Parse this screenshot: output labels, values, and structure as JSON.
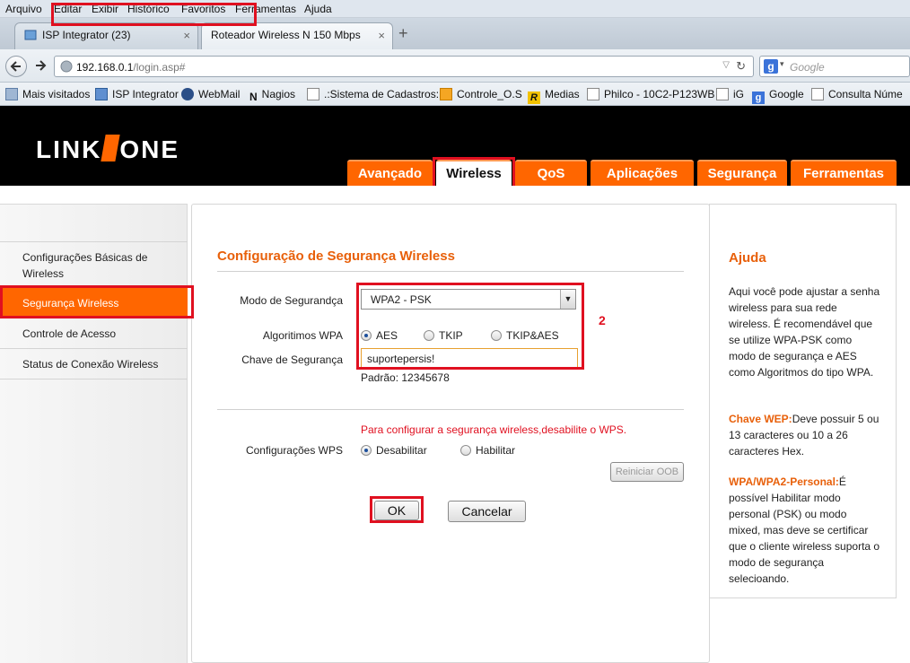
{
  "browser": {
    "menu": [
      "Arquivo",
      "Editar",
      "Exibir",
      "Histórico",
      "Favoritos",
      "Ferramentas",
      "Ajuda"
    ],
    "tabs": [
      {
        "label": "ISP Integrator (23)",
        "close": "×"
      },
      {
        "label": "Roteador Wireless N 150 Mbps",
        "close": "×"
      }
    ],
    "new_tab": "+",
    "url_host": "192.168.0.1",
    "url_path": "/login.asp#",
    "search_placeholder": "Google",
    "bookmarks": [
      "Mais visitados",
      "ISP Integrator",
      "WebMail",
      "Nagios",
      ".:Sistema de Cadastros:.",
      "Controle_O.S",
      "Medias",
      "Philco - 10C2-P123WB",
      "iG",
      "Google",
      "Consulta Núme"
    ]
  },
  "router": {
    "logo_left": "LINK",
    "logo_right": "ONE",
    "tabs": [
      "Avançado",
      "Wireless",
      "QoS",
      "Aplicações",
      "Segurança",
      "Ferramentas"
    ],
    "sidebar": [
      "Configurações Básicas de Wireless",
      "Segurança Wireless",
      "Controle de Acesso",
      "Status de Conexão Wireless"
    ],
    "main": {
      "title": "Configuração de Segurança Wireless",
      "mode_label": "Modo de Segurandça",
      "mode_value": "WPA2 - PSK",
      "algo_label": "Algoritimos WPA",
      "algo_options": [
        "AES",
        "TKIP",
        "TKIP&AES"
      ],
      "algo_selected": "AES",
      "key_label": "Chave de Segurança",
      "key_value": "suportepersis!",
      "default_text": "Padrão: 12345678",
      "annotation": "2",
      "wps_warning": "Para configurar a segurança wireless,desabilite o WPS.",
      "wps_label": "Configurações WPS",
      "wps_options": [
        "Desabilitar",
        "Habilitar"
      ],
      "wps_selected": "Desabilitar",
      "reset_oob": "Reiniciar OOB",
      "ok": "OK",
      "cancel": "Cancelar"
    },
    "help": {
      "title": "Ajuda",
      "intro": "Aqui você pode ajustar a senha wireless para sua rede wireless. É recomendável que se utilize WPA-PSK como modo de segurança e AES como Algoritmos do tipo WPA.",
      "wep_label": "Chave WEP:",
      "wep_text": "Deve possuir 5 ou 13 caracteres ou 10 a 26 caracteres Hex.",
      "wpa_label": "WPA/WPA2-Personal:",
      "wpa_text": "É possível Habilitar modo personal (PSK) ou modo mixed, mas deve se certificar que o cliente wireless suporta o modo de segurança selecioando."
    }
  },
  "colors": {
    "accent": "#ff6600",
    "highlight": "#e01020"
  }
}
